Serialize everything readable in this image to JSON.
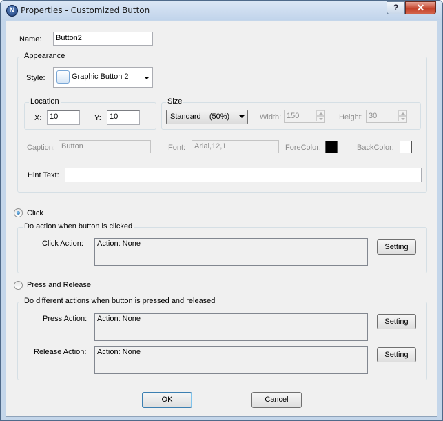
{
  "window": {
    "title": "Properties - Customized Button",
    "icon_letter": "N",
    "help_label": "?",
    "close_label": "✕"
  },
  "name": {
    "label": "Name:",
    "value": "Button2"
  },
  "appearance": {
    "title": "Appearance",
    "style_label": "Style:",
    "style_value": "Graphic Button 2",
    "location": {
      "title": "Location",
      "x_label": "X:",
      "x_value": "10",
      "y_label": "Y:",
      "y_value": "10"
    },
    "size": {
      "title": "Size",
      "preset_value": "Standard    (50%)",
      "width_label": "Width:",
      "width_value": "150",
      "height_label": "Height:",
      "height_value": "30"
    },
    "caption_label": "Caption:",
    "caption_value": "Button",
    "font_label": "Font:",
    "font_value": "Arial,12,1",
    "forecolor_label": "ForeColor:",
    "forecolor": "#000000",
    "backcolor_label": "BackColor:",
    "backcolor": "#ffffff",
    "hint_label": "Hint Text:",
    "hint_value": ""
  },
  "click_mode": {
    "label": "Click",
    "selected": true,
    "group_title": "Do action when button is clicked",
    "action_label": "Click Action:",
    "action_value": "Action: None",
    "setting_label": "Setting"
  },
  "press_mode": {
    "label": "Press and Release",
    "selected": false,
    "group_title": "Do different actions when button is pressed and released",
    "press_label": "Press Action:",
    "press_value": "Action: None",
    "press_setting_label": "Setting",
    "release_label": "Release Action:",
    "release_value": "Action: None",
    "release_setting_label": "Setting"
  },
  "footer": {
    "ok_label": "OK",
    "cancel_label": "Cancel"
  }
}
